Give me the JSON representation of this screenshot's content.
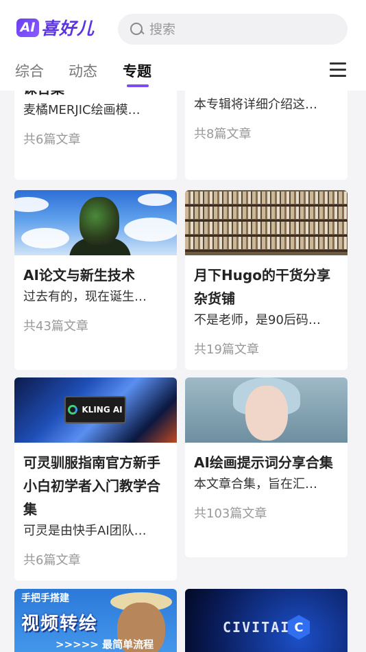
{
  "header": {
    "logo_badge": "AI",
    "logo_text": "喜好儿",
    "search_placeholder": "搜索"
  },
  "tabs": [
    {
      "label": "综合",
      "active": false
    },
    {
      "label": "动态",
      "active": false
    },
    {
      "label": "专题",
      "active": true
    }
  ],
  "accent_color": "#7b4cf3",
  "cards": [
    {
      "title": "课合集",
      "desc": "麦橘MERJIC绘画模…",
      "count": "共6篇文章"
    },
    {
      "title": "",
      "desc": "本专辑将详细介绍这…",
      "count": "共8篇文章"
    },
    {
      "title": "AI论文与新生技术",
      "desc": "过去有的，现在诞生…",
      "count": "共43篇文章"
    },
    {
      "title": "月下Hugo的干货分享杂货铺",
      "desc": "不是老师，是90后码…",
      "count": "共19篇文章"
    },
    {
      "title": "可灵驯服指南官方新手小白初学者入门教学合集",
      "desc": "可灵是由快手AI团队…",
      "count": "共6篇文章",
      "cover_text": "KLING AI"
    },
    {
      "title": "AI绘画提示词分享合集",
      "desc": "本文章合集，旨在汇…",
      "count": "共103篇文章"
    },
    {
      "cover_top": "手把手搭建",
      "cover_main": "视频转绘",
      "cover_bottom": ">>>>> 最简单流程"
    },
    {
      "cover_text": "CIVITAI",
      "cover_badge": "C"
    }
  ]
}
